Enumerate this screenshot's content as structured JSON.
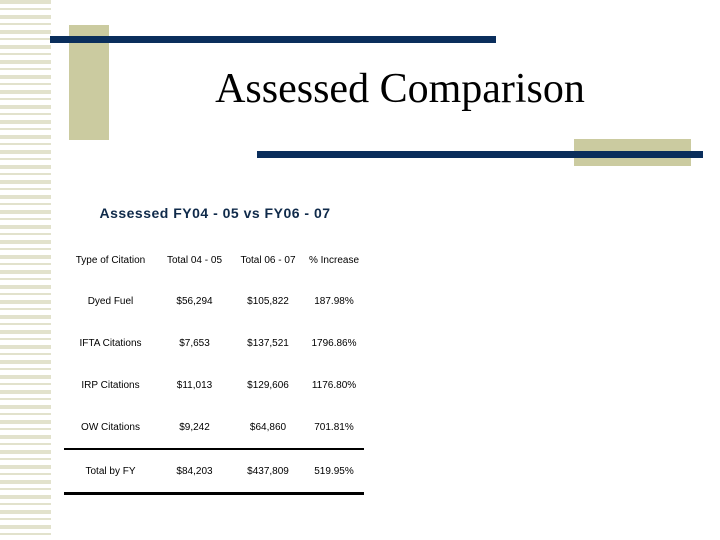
{
  "slide": {
    "title": "Assessed Comparison",
    "subtitle": "Assessed FY04 - 05 vs FY06 - 07"
  },
  "table": {
    "headers": [
      "Type of Citation",
      "Total 04 - 05",
      "Total 06 - 07",
      "% Increase"
    ],
    "rows": [
      [
        "Dyed Fuel",
        "$56,294",
        "$105,822",
        "187.98%"
      ],
      [
        "IFTA Citations",
        "$7,653",
        "$137,521",
        "1796.86%"
      ],
      [
        "IRP Citations",
        "$11,013",
        "$129,606",
        "1176.80%"
      ],
      [
        "OW Citations",
        "$9,242",
        "$64,860",
        "701.81%"
      ],
      [
        "Total by FY",
        "$84,203",
        "$437,809",
        "519.95%"
      ]
    ]
  },
  "colors": {
    "navy": "#0a2e5c",
    "tan": "#cbcba0",
    "stripe": "#e2e2cc"
  }
}
